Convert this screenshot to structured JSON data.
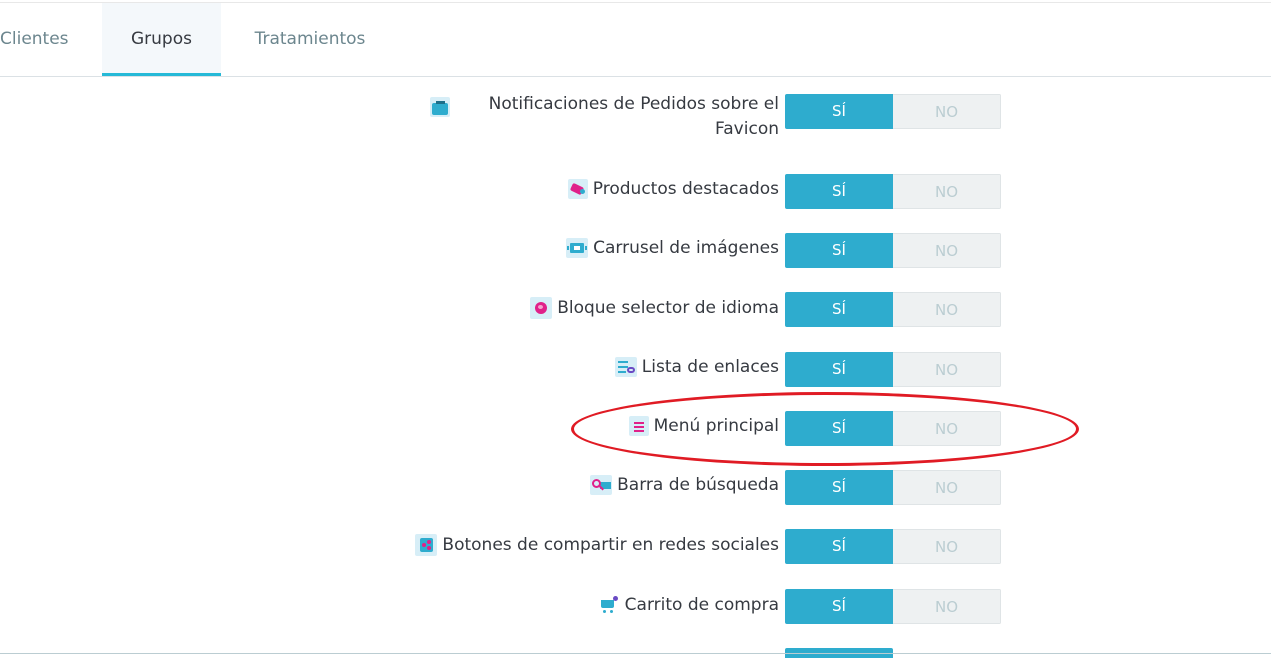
{
  "tabs": [
    {
      "label": "Clientes",
      "active": false
    },
    {
      "label": "Grupos",
      "active": true
    },
    {
      "label": "Tratamientos",
      "active": false
    }
  ],
  "toggle": {
    "yes": "SÍ",
    "no": "NO"
  },
  "modules": [
    {
      "label": "Notificaciones de Pedidos sobre el Favicon",
      "icon": "favicon-notification-icon",
      "value": "yes"
    },
    {
      "label": "Productos destacados",
      "icon": "featured-products-icon",
      "value": "yes"
    },
    {
      "label": "Carrusel de imágenes",
      "icon": "image-carousel-icon",
      "value": "yes"
    },
    {
      "label": "Bloque selector de idioma",
      "icon": "language-selector-icon",
      "value": "yes"
    },
    {
      "label": "Lista de enlaces",
      "icon": "link-list-icon",
      "value": "yes"
    },
    {
      "label": "Menú principal",
      "icon": "main-menu-icon",
      "value": "yes"
    },
    {
      "label": "Barra de búsqueda",
      "icon": "search-bar-icon",
      "value": "yes"
    },
    {
      "label": "Botones de compartir en redes sociales",
      "icon": "social-share-icon",
      "value": "yes"
    },
    {
      "label": "Carrito de compra",
      "icon": "shopping-cart-icon",
      "value": "yes"
    }
  ],
  "colors": {
    "accent": "#2eacce",
    "tab_underline": "#25b9d7",
    "highlight": "#e01b24"
  }
}
